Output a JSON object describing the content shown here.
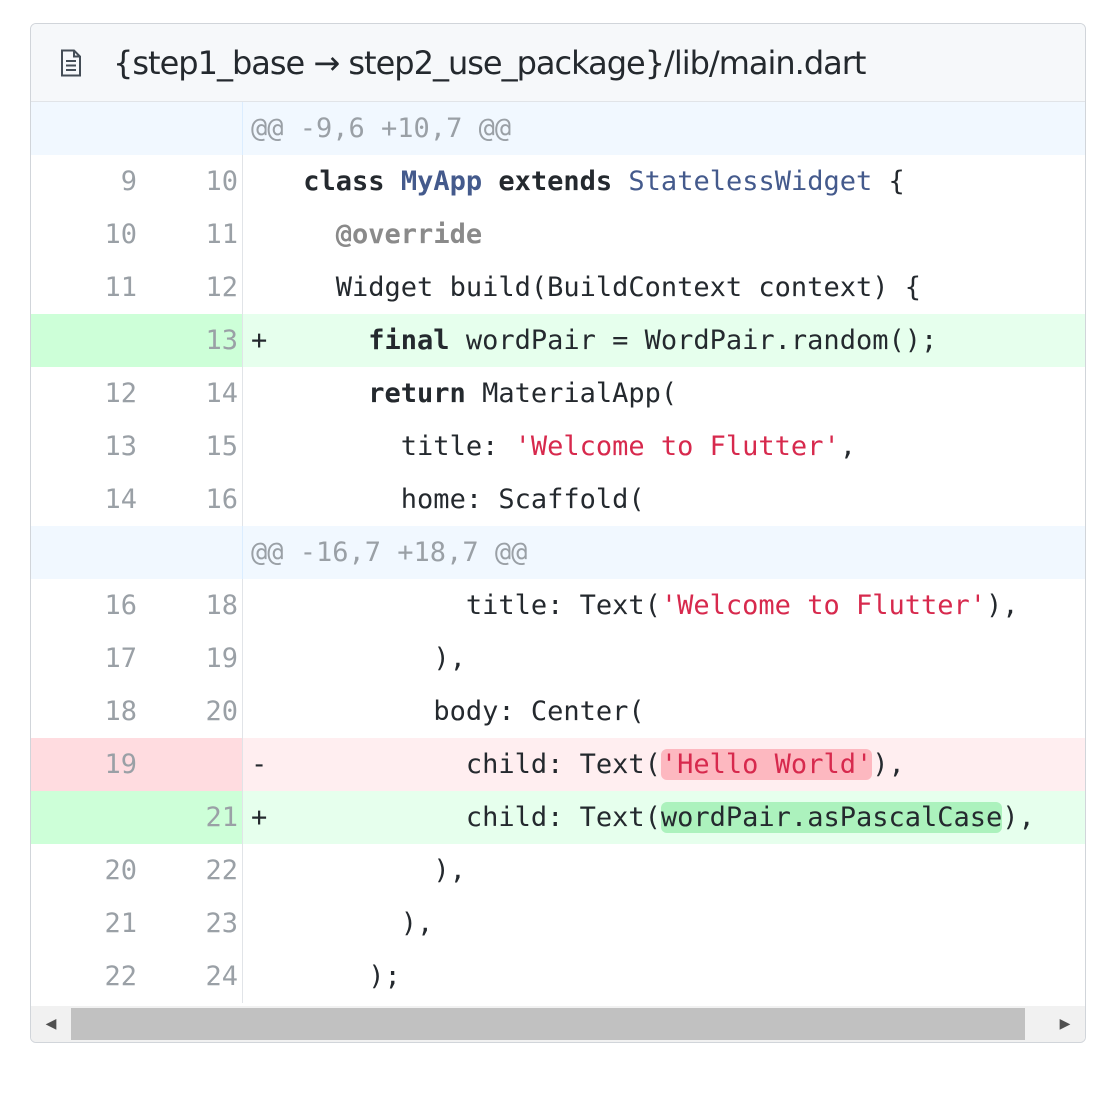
{
  "file": {
    "path": "{step1_base → step2_use_package}/lib/main.dart",
    "icon": "file-text-icon"
  },
  "rows": [
    {
      "type": "hunk",
      "text": "@@ -9,6 +10,7 @@"
    },
    {
      "type": "ctx",
      "old": "9",
      "new": "10",
      "marker": ""
    },
    {
      "type": "ctx",
      "old": "10",
      "new": "11",
      "marker": ""
    },
    {
      "type": "ctx",
      "old": "11",
      "new": "12",
      "marker": ""
    },
    {
      "type": "add",
      "old": "",
      "new": "13",
      "marker": "+"
    },
    {
      "type": "ctx",
      "old": "12",
      "new": "14",
      "marker": ""
    },
    {
      "type": "ctx",
      "old": "13",
      "new": "15",
      "marker": ""
    },
    {
      "type": "ctx",
      "old": "14",
      "new": "16",
      "marker": ""
    },
    {
      "type": "hunk",
      "text": "@@ -16,7 +18,7 @@"
    },
    {
      "type": "ctx",
      "old": "16",
      "new": "18",
      "marker": ""
    },
    {
      "type": "ctx",
      "old": "17",
      "new": "19",
      "marker": ""
    },
    {
      "type": "ctx",
      "old": "18",
      "new": "20",
      "marker": ""
    },
    {
      "type": "del",
      "old": "19",
      "new": "",
      "marker": "-"
    },
    {
      "type": "add",
      "old": "",
      "new": "21",
      "marker": "+"
    },
    {
      "type": "ctx",
      "old": "20",
      "new": "22",
      "marker": ""
    },
    {
      "type": "ctx",
      "old": "21",
      "new": "23",
      "marker": ""
    },
    {
      "type": "ctx",
      "old": "22",
      "new": "24",
      "marker": ""
    }
  ],
  "code": {
    "l1": {
      "indent": " ",
      "kw1": "class",
      "sp1": " ",
      "name": "MyApp",
      "sp2": " ",
      "kw2": "extends",
      "sp3": " ",
      "type": "StatelessWidget",
      "rest": " {"
    },
    "l2": {
      "indent": "   ",
      "anno": "@override"
    },
    "l3": {
      "indent": "   ",
      "text": "Widget build(BuildContext context) {"
    },
    "l4": {
      "indent": "     ",
      "kw": "final",
      "rest": " wordPair = WordPair.random();"
    },
    "l5": {
      "indent": "     ",
      "kw": "return",
      "rest": " MaterialApp("
    },
    "l6": {
      "indent": "       ",
      "pre": "title: ",
      "str": "'Welcome to Flutter'",
      "post": ","
    },
    "l7": {
      "indent": "       ",
      "text": "home: Scaffold("
    },
    "l8": {
      "indent": "           ",
      "pre": "title: Text(",
      "str": "'Welcome to Flutter'",
      "post": "),"
    },
    "l9": {
      "indent": "         ",
      "text": "),"
    },
    "l10": {
      "indent": "         ",
      "text": "body: Center("
    },
    "l11": {
      "indent": "           ",
      "pre": "child: Text(",
      "hl": "'Hello World'",
      "post": "),"
    },
    "l12": {
      "indent": "           ",
      "pre": "child: Text(",
      "hl": "wordPair.asPascalCase",
      "post": "),"
    },
    "l13": {
      "indent": "         ",
      "text": "),"
    },
    "l14": {
      "indent": "       ",
      "text": "),"
    },
    "l15": {
      "indent": "     ",
      "text": ");"
    }
  },
  "scrollbar": {
    "left_icon": "triangle-left-icon",
    "right_icon": "triangle-right-icon",
    "left_glyph": "◀",
    "right_glyph": "▶"
  },
  "colors": {
    "add_bg": "#e6ffed",
    "del_bg": "#ffeef0",
    "hunk_bg": "#f1f8ff",
    "string": "#d7294d",
    "type": "#445a8c"
  }
}
